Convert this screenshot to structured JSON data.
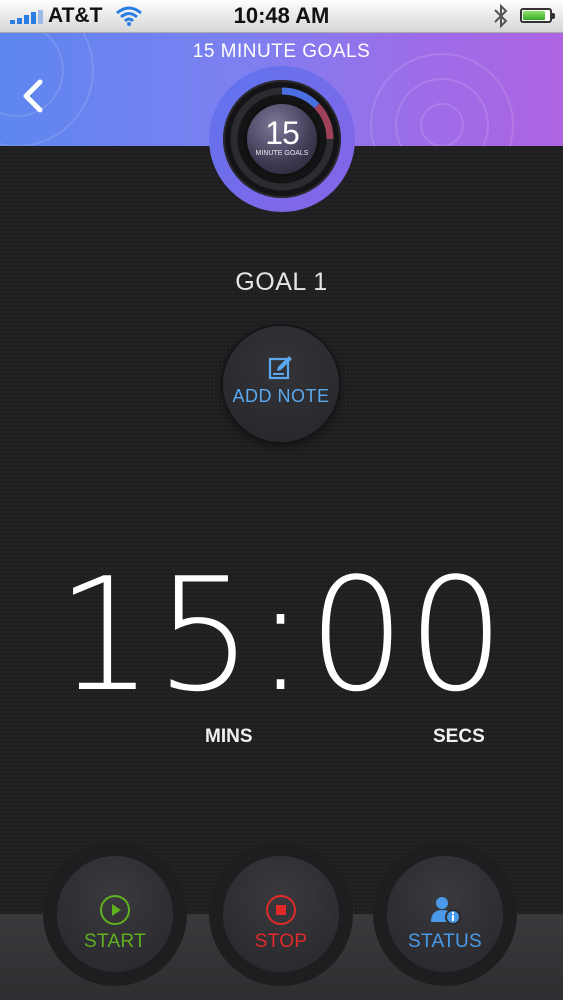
{
  "status_bar": {
    "carrier": "AT&T",
    "time": "10:48 AM",
    "signal_bars": 4,
    "battery_level": 0.85,
    "icons": [
      "signal-icon",
      "wifi-icon",
      "bluetooth-icon",
      "battery-icon"
    ]
  },
  "header": {
    "title": "15 MINUTE GOALS",
    "back_icon": "chevron-left-icon",
    "logo_number": "15",
    "logo_subtitle": "MINUTE GOALS"
  },
  "main": {
    "goal_title": "GOAL 1",
    "add_note_label": "ADD NOTE",
    "add_note_icon": "edit-note-icon",
    "timer": "15:00",
    "minutes_label": "MINS",
    "seconds_label": "SECS"
  },
  "controls": {
    "start_label": "START",
    "stop_label": "STOP",
    "status_label": "STATUS"
  },
  "colors": {
    "header_gradient_start": "#5d86ef",
    "header_gradient_end": "#ad64e1",
    "accent_blue": "#5aa9ef",
    "start_green": "#5fb11f",
    "stop_red": "#e02a2a",
    "status_blue": "#4a9ae8",
    "background": "#1f1f21"
  }
}
